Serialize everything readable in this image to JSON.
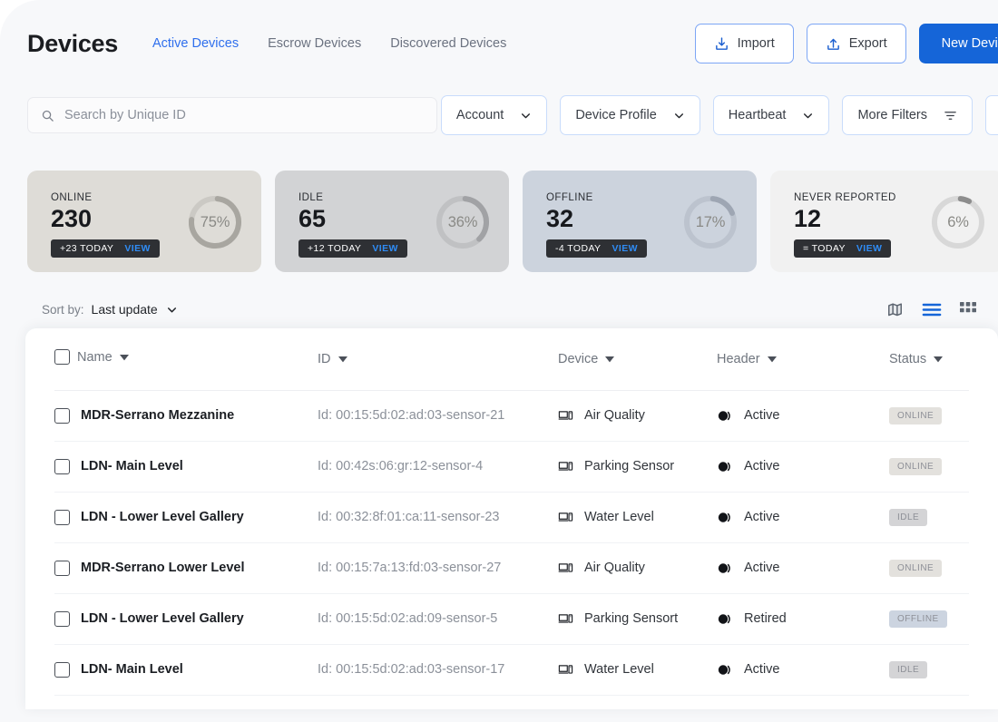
{
  "header": {
    "title": "Devices",
    "tabs": [
      {
        "label": "Active Devices",
        "active": true
      },
      {
        "label": "Escrow Devices",
        "active": false
      },
      {
        "label": "Discovered Devices",
        "active": false
      }
    ],
    "actions": {
      "import_label": "Import",
      "export_label": "Export",
      "new_device_label": "New Device"
    }
  },
  "search": {
    "placeholder": "Search by Unique ID",
    "value": "",
    "icon": "search-icon"
  },
  "filters": [
    {
      "label": "Account",
      "icon": "chevron-down-icon"
    },
    {
      "label": "Device Profile",
      "icon": "chevron-down-icon"
    },
    {
      "label": "Heartbeat",
      "icon": "chevron-down-icon"
    },
    {
      "label": "More Filters",
      "icon": "filter-icon"
    }
  ],
  "save_filter_icon": "save-disk-icon",
  "stats": [
    {
      "label": "ONLINE",
      "value": "230",
      "delta": "+23 TODAY",
      "view_label": "VIEW",
      "percent_label": "75%",
      "percent": 75,
      "bg": "#dedcd7",
      "ring_track": "#cbc9c4",
      "ring_fill": "#a8a6a0"
    },
    {
      "label": "IDLE",
      "value": "65",
      "delta": "+12 TODAY",
      "view_label": "VIEW",
      "percent_label": "36%",
      "percent": 36,
      "bg": "#d2d3d5",
      "ring_track": "#c0c1c3",
      "ring_fill": "#a1a2a5"
    },
    {
      "label": "OFFLINE",
      "value": "32",
      "delta": "-4 TODAY",
      "view_label": "VIEW",
      "percent_label": "17%",
      "percent": 17,
      "bg": "#ccd3dd",
      "ring_track": "#bcc3ce",
      "ring_fill": "#9ea6b3"
    },
    {
      "label": "NEVER REPORTED",
      "value": "12",
      "delta": "= TODAY",
      "view_label": "VIEW",
      "percent_label": "6%",
      "percent": 6,
      "bg": "#f1f1f1",
      "ring_track": "#d8d8d8",
      "ring_fill": "#8d8d8d"
    }
  ],
  "sort": {
    "prefix": "Sort by:",
    "value": "Last update"
  },
  "view_toggles": [
    {
      "name": "map-view-icon",
      "active": false
    },
    {
      "name": "list-view-icon",
      "active": true
    },
    {
      "name": "grid-view-icon",
      "active": false
    }
  ],
  "table": {
    "columns": [
      {
        "label": "Name"
      },
      {
        "label": "ID"
      },
      {
        "label": "Device"
      },
      {
        "label": "Header"
      },
      {
        "label": "Status"
      }
    ],
    "rows": [
      {
        "name": "MDR-Serrano Mezzanine",
        "id": "Id: 00:15:5d:02:ad:03-sensor-21",
        "device": "Air Quality",
        "header": "Active",
        "status": "ONLINE",
        "status_kind": "online"
      },
      {
        "name": "LDN- Main Level",
        "id": "Id: 00:42s:06:gr:12-sensor-4",
        "device": "Parking Sensor",
        "header": "Active",
        "status": "ONLINE",
        "status_kind": "online"
      },
      {
        "name": "LDN - Lower Level Gallery",
        "id": "Id: 00:32:8f:01:ca:11-sensor-23",
        "device": "Water Level",
        "header": "Active",
        "status": "IDLE",
        "status_kind": "idle"
      },
      {
        "name": "MDR-Serrano Lower Level",
        "id": "Id: 00:15:7a:13:fd:03-sensor-27",
        "device": "Air Quality",
        "header": "Active",
        "status": "ONLINE",
        "status_kind": "online"
      },
      {
        "name": "LDN - Lower Level Gallery",
        "id": "Id: 00:15:5d:02:ad:09-sensor-5",
        "device": "Parking Sensort",
        "header": "Retired",
        "status": "OFFLINE",
        "status_kind": "offline"
      },
      {
        "name": "LDN- Main Level",
        "id": "Id: 00:15:5d:02:ad:03-sensor-17",
        "device": "Water Level",
        "header": "Active",
        "status": "IDLE",
        "status_kind": "idle"
      }
    ]
  }
}
